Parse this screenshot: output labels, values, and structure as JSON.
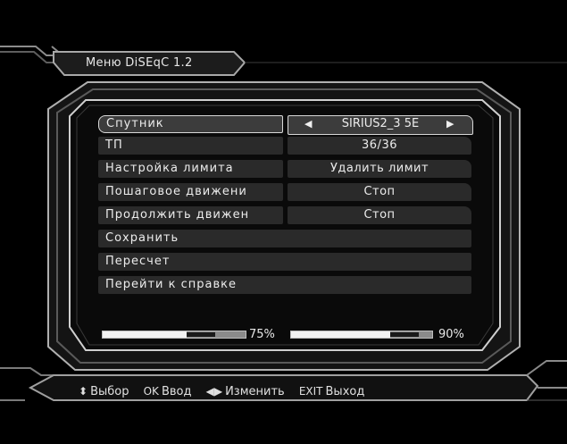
{
  "title": "Меню DiSEqC 1.2",
  "menu": [
    {
      "label": "Спутник",
      "value": "SIRIUS2_3 5E",
      "selected": true,
      "has_value": true
    },
    {
      "label": "ТП",
      "value": "36/36",
      "selected": false,
      "has_value": true
    },
    {
      "label": "Настройка лимита",
      "value": "Удалить лимит",
      "selected": false,
      "has_value": true
    },
    {
      "label": "Пошаговое движени",
      "value": "Стоп",
      "selected": false,
      "has_value": true
    },
    {
      "label": "Продолжить движен",
      "value": "Стоп",
      "selected": false,
      "has_value": true
    },
    {
      "label": "Сохранить",
      "value": "",
      "selected": false,
      "has_value": false
    },
    {
      "label": "Пересчет",
      "value": "",
      "selected": false,
      "has_value": false
    },
    {
      "label": "Перейти к справке",
      "value": "",
      "selected": false,
      "has_value": false
    }
  ],
  "signal": {
    "strength_label": "75%",
    "strength": 0.75,
    "quality_label": "90%",
    "quality": 0.9
  },
  "help": [
    {
      "key": "⬍",
      "key_icon": "up-down-icon",
      "label": "Выбор"
    },
    {
      "key": "OK",
      "key_icon": "ok-key",
      "label": "Ввод"
    },
    {
      "key": "◀▶",
      "key_icon": "left-right-icon",
      "label": "Изменить"
    },
    {
      "key": "EXIT",
      "key_icon": "exit-key",
      "label": "Выход"
    }
  ],
  "colors": {
    "background": "#000000",
    "frame": "#9a9a9a",
    "row": "#2a2a2a",
    "selected_border": "#d8d8d8",
    "text": "#ececec"
  }
}
